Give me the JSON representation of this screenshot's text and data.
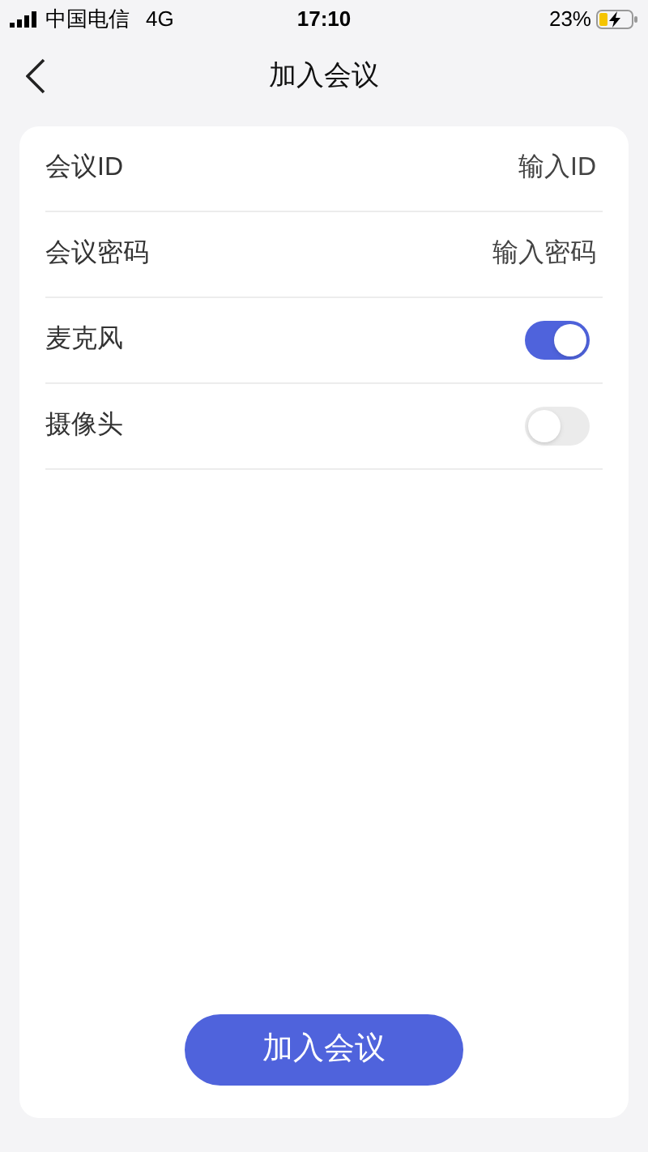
{
  "status_bar": {
    "carrier": "中国电信",
    "network": "4G",
    "time": "17:10",
    "battery": "23%"
  },
  "header": {
    "title": "加入会议"
  },
  "rows": [
    {
      "kind": "input",
      "label": "会议ID",
      "placeholder": "输入ID"
    },
    {
      "kind": "input",
      "label": "会议密码",
      "placeholder": "输入密码"
    },
    {
      "kind": "toggle",
      "label": "麦克风",
      "on": true
    },
    {
      "kind": "toggle",
      "label": "摄像头",
      "on": false
    }
  ],
  "submit_button": "加入会议"
}
